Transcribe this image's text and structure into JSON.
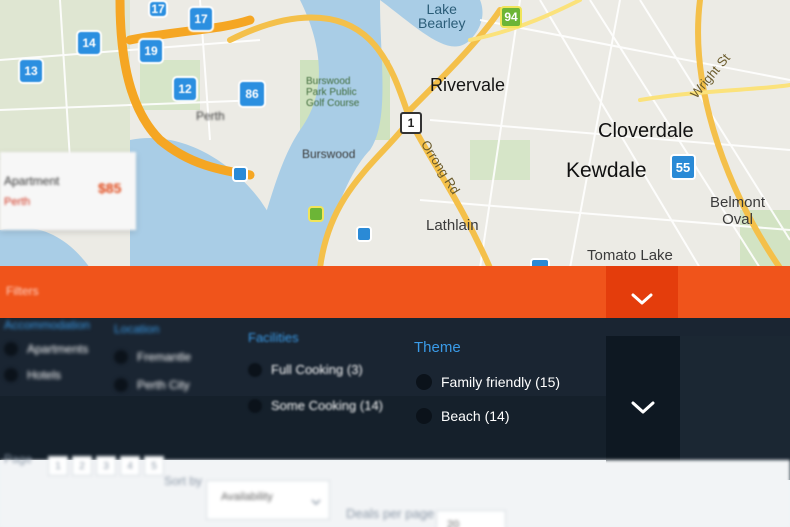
{
  "map": {
    "labels": {
      "lake_bearley": "Lake\nBearley",
      "rivervale": "Rivervale",
      "cloverdale": "Cloverdale",
      "kewdale": "Kewdale",
      "belmont_oval": "Belmont\nOval",
      "lathlain": "Lathlain",
      "tomato_lake": "Tomato Lake",
      "burswood": "Burswood",
      "burswood_golf": "Burswood\nPark Public\nGolf Course",
      "orrong_rd": "Orrong Rd",
      "wright_st": "Wright St",
      "perth": "Perth"
    },
    "shields": {
      "route_94": "94",
      "route_55": "55",
      "route_1": "1"
    },
    "pins": [
      "17",
      "14",
      "19",
      "13",
      "12",
      "17",
      "86"
    ],
    "overlay": {
      "line1": "Apartment",
      "line2": "Perth",
      "price": "$85"
    }
  },
  "orange_bar": {
    "label": "Filters",
    "toggle_icon": "chevron-down-icon"
  },
  "filters": {
    "groups": [
      {
        "title": "Accommodation",
        "options": [
          "Apartments",
          "Hotels"
        ]
      },
      {
        "title": "Location",
        "options": [
          "Fremantle",
          "Perth City"
        ]
      },
      {
        "title": "Facilities",
        "options": [
          "Full Cooking (3)",
          "Some Cooking (14)"
        ]
      },
      {
        "title": "Theme",
        "options": [
          "Family friendly (15)",
          "Beach (14)"
        ]
      }
    ],
    "toggle_icon": "chevron-down-icon"
  },
  "lower": {
    "pagination_label": "Page",
    "pages": [
      "1",
      "2",
      "3",
      "4",
      "5"
    ],
    "sort_label": "Sort by",
    "sort_value": "Availability",
    "per_page_label": "Deals per page",
    "per_page_value": "20"
  },
  "colors": {
    "orange": "#f0541b",
    "orange_dark": "#e43d0c",
    "panel_dark": "#15202b",
    "accent_blue": "#3a9be8"
  }
}
